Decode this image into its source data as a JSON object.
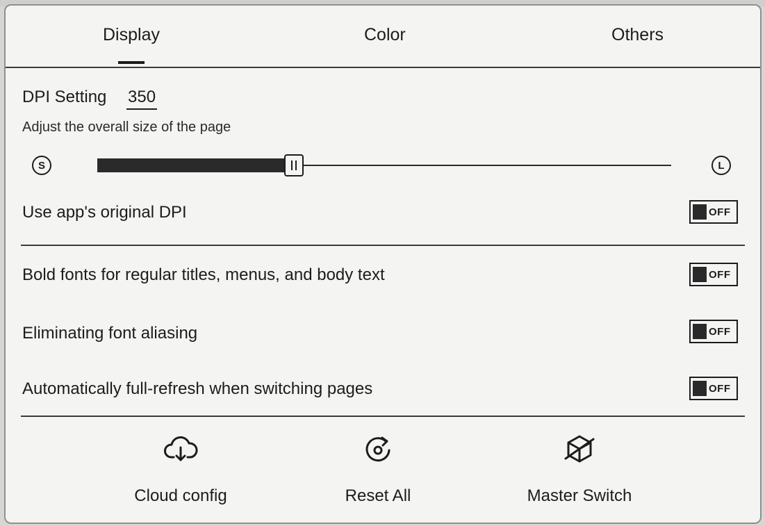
{
  "tabs": [
    {
      "label": "Display",
      "active": true
    },
    {
      "label": "Color",
      "active": false
    },
    {
      "label": "Others",
      "active": false
    }
  ],
  "dpi": {
    "title": "DPI Setting",
    "value": "350",
    "description": "Adjust the overall size of the page",
    "slider_min_label": "S",
    "slider_max_label": "L",
    "slider_fraction": 0.33
  },
  "settings": [
    {
      "label": "Use app's original DPI",
      "state": "OFF"
    },
    {
      "label": "Bold fonts for regular titles, menus, and body text",
      "state": "OFF"
    },
    {
      "label": "Eliminating font aliasing",
      "state": "OFF"
    },
    {
      "label": "Automatically full-refresh when switching pages",
      "state": "OFF"
    }
  ],
  "actions": [
    {
      "label": "Cloud config",
      "icon": "cloud-download-icon"
    },
    {
      "label": "Reset All",
      "icon": "reset-icon"
    },
    {
      "label": "Master Switch",
      "icon": "master-switch-icon"
    }
  ],
  "colors": {
    "panel": "#f4f4f2",
    "ink": "#1c1c1c"
  }
}
